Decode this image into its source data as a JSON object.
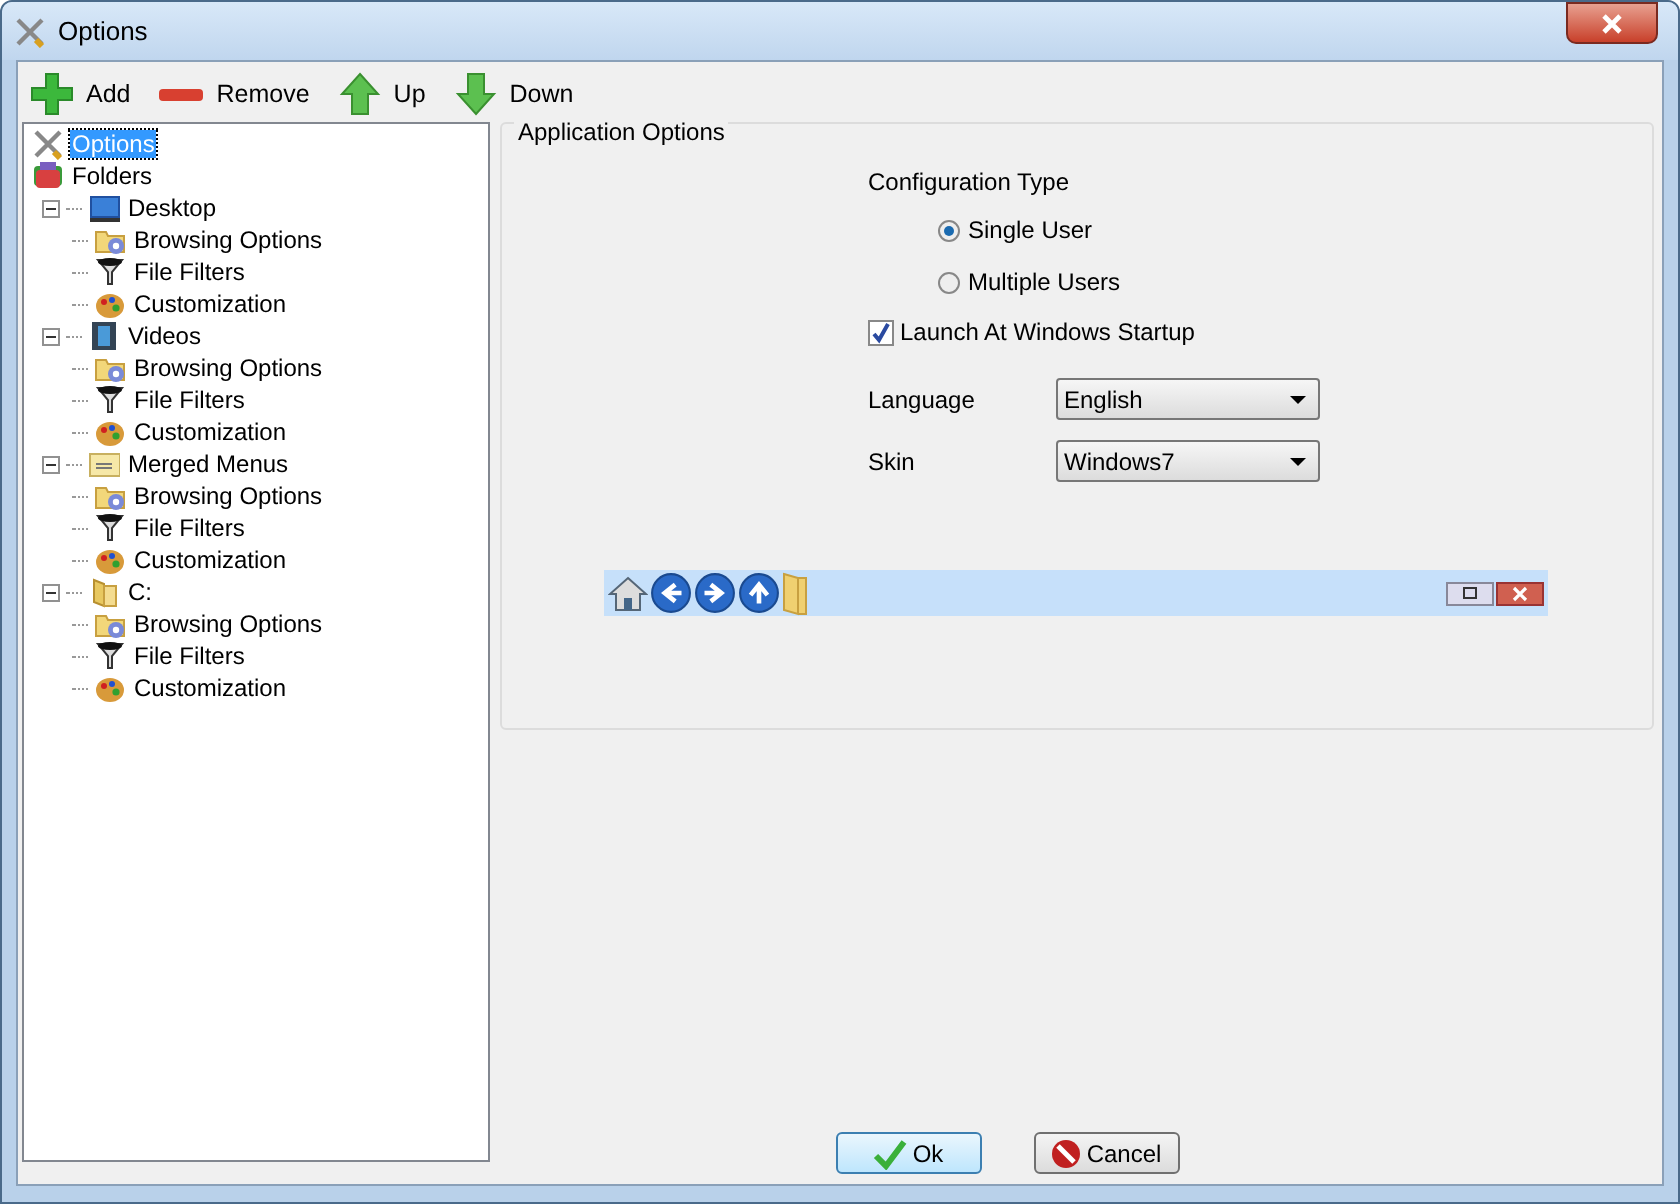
{
  "window": {
    "title": "Options"
  },
  "toolbar": [
    {
      "kind": "add",
      "label": "Add"
    },
    {
      "kind": "remove",
      "label": "Remove"
    },
    {
      "kind": "up",
      "label": "Up"
    },
    {
      "kind": "down",
      "label": "Down"
    }
  ],
  "tree": [
    {
      "kind": "options",
      "label": "Options",
      "selected": true
    },
    {
      "kind": "folders",
      "label": "Folders",
      "selected": false,
      "children": [
        {
          "kind": "desktop",
          "label": "Desktop",
          "selected": false,
          "expanded": true,
          "children": [
            {
              "kind": "browsing",
              "label": "Browsing Options",
              "selected": false
            },
            {
              "kind": "filter",
              "label": "File Filters",
              "selected": false
            },
            {
              "kind": "custom",
              "label": "Customization",
              "selected": false
            }
          ]
        },
        {
          "kind": "videos",
          "label": "Videos",
          "selected": false,
          "expanded": true,
          "children": [
            {
              "kind": "browsing",
              "label": "Browsing Options",
              "selected": false
            },
            {
              "kind": "filter",
              "label": "File Filters",
              "selected": false
            },
            {
              "kind": "custom",
              "label": "Customization",
              "selected": false
            }
          ]
        },
        {
          "kind": "merged",
          "label": "Merged Menus",
          "selected": false,
          "expanded": true,
          "children": [
            {
              "kind": "browsing",
              "label": "Browsing Options",
              "selected": false
            },
            {
              "kind": "filter",
              "label": "File Filters",
              "selected": false
            },
            {
              "kind": "custom",
              "label": "Customization",
              "selected": false
            }
          ]
        },
        {
          "kind": "drive",
          "label": "C:",
          "selected": false,
          "expanded": true,
          "children": [
            {
              "kind": "browsing",
              "label": "Browsing Options",
              "selected": false
            },
            {
              "kind": "filter",
              "label": "File Filters",
              "selected": false
            },
            {
              "kind": "custom",
              "label": "Customization",
              "selected": false
            }
          ]
        }
      ]
    }
  ],
  "group": {
    "title": "Application Options",
    "config_label": "Configuration Type",
    "radios": [
      {
        "label": "Single User",
        "selected": true
      },
      {
        "label": "Multiple Users",
        "selected": false
      }
    ],
    "launch_checkbox": {
      "label": "Launch At Windows Startup",
      "checked": true
    },
    "fields": [
      {
        "label": "Language",
        "value": "English"
      },
      {
        "label": "Skin",
        "value": "Windows7"
      }
    ]
  },
  "buttons": [
    {
      "kind": "ok",
      "label": "Ok"
    },
    {
      "kind": "cancel",
      "label": "Cancel"
    }
  ]
}
